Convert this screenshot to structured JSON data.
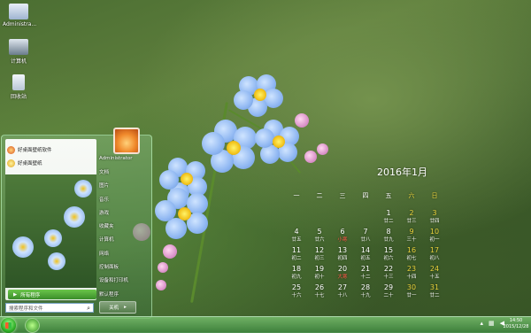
{
  "desktop": {
    "icons": [
      {
        "label": "Administra...",
        "icon": "user-folder-icon"
      },
      {
        "label": "计算机",
        "icon": "computer-icon"
      },
      {
        "label": "回收站",
        "icon": "recycle-bin-icon"
      }
    ]
  },
  "calendar": {
    "title": "2016年1月",
    "weekdays": [
      "一",
      "二",
      "三",
      "四",
      "五",
      "六",
      "日"
    ],
    "weekday_colors": [
      "#ffffff",
      "#ffffff",
      "#ffffff",
      "#ffffff",
      "#ffffff",
      "#e8d13b",
      "#e8d13b"
    ],
    "weeks": [
      [
        null,
        null,
        null,
        null,
        {
          "day": "1",
          "lunar": "廿二"
        },
        {
          "day": "2",
          "lunar": "廿三"
        },
        {
          "day": "3",
          "lunar": "廿四"
        }
      ],
      [
        {
          "day": "4",
          "lunar": "廿五"
        },
        {
          "day": "5",
          "lunar": "廿六"
        },
        {
          "day": "6",
          "lunar": "小寒"
        },
        {
          "day": "7",
          "lunar": "廿八"
        },
        {
          "day": "8",
          "lunar": "廿九"
        },
        {
          "day": "9",
          "lunar": "三十"
        },
        {
          "day": "10",
          "lunar": "初一"
        }
      ],
      [
        {
          "day": "11",
          "lunar": "初二"
        },
        {
          "day": "12",
          "lunar": "初三"
        },
        {
          "day": "13",
          "lunar": "初四"
        },
        {
          "day": "14",
          "lunar": "初五"
        },
        {
          "day": "15",
          "lunar": "初六"
        },
        {
          "day": "16",
          "lunar": "初七"
        },
        {
          "day": "17",
          "lunar": "初八"
        }
      ],
      [
        {
          "day": "18",
          "lunar": "初九"
        },
        {
          "day": "19",
          "lunar": "初十"
        },
        {
          "day": "20",
          "lunar": "大寒"
        },
        {
          "day": "21",
          "lunar": "十二"
        },
        {
          "day": "22",
          "lunar": "十三"
        },
        {
          "day": "23",
          "lunar": "十四"
        },
        {
          "day": "24",
          "lunar": "十五"
        }
      ],
      [
        {
          "day": "25",
          "lunar": "十六"
        },
        {
          "day": "26",
          "lunar": "十七"
        },
        {
          "day": "27",
          "lunar": "十八"
        },
        {
          "day": "28",
          "lunar": "十九"
        },
        {
          "day": "29",
          "lunar": "二十"
        },
        {
          "day": "30",
          "lunar": "廿一"
        },
        {
          "day": "31",
          "lunar": "廿二"
        }
      ]
    ],
    "colors": {
      "normal": "#ffffff",
      "weekend": "#e8d13b",
      "holiday": "#ff5a4a"
    }
  },
  "start_menu": {
    "pinned": [
      {
        "label": "好桌面壁纸软件",
        "icon": "app-orange-icon"
      },
      {
        "label": "好桌面壁纸",
        "icon": "app-yellow-icon"
      }
    ],
    "all_programs": "所有程序",
    "search_placeholder": "搜索程序和文件",
    "right_items": [
      "Administrator",
      "文档",
      "图片",
      "音乐",
      "游戏",
      "收藏夹",
      "计算机",
      "网络",
      "控制面板",
      "设备和打印机",
      "默认程序"
    ],
    "shutdown_label": "关机"
  },
  "taskbar": {
    "time": "14:50",
    "date": "2015/12/28",
    "tray_icons": [
      "show-hidden-icon",
      "network-icon",
      "volume-icon"
    ]
  }
}
